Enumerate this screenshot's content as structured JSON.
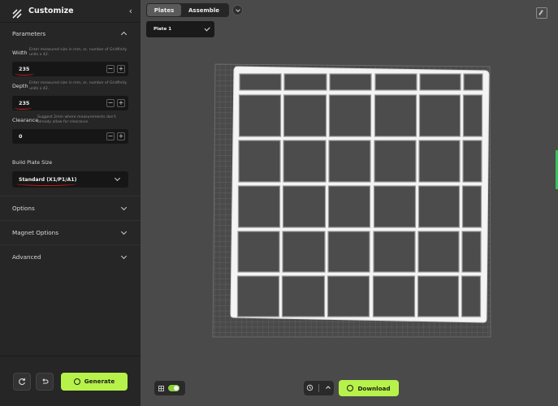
{
  "sidebar": {
    "title": "Customize",
    "parameters_label": "Parameters",
    "width": {
      "label": "Width",
      "help": "Enter measured size in mm, or, number of Gridfinity units x 42.",
      "value": "235"
    },
    "depth": {
      "label": "Depth",
      "help": "Enter measured size in mm, or, number of Gridfinity units x 42.",
      "value": "235"
    },
    "clearance": {
      "label": "Clearance",
      "help": "Suggest 2mm where measurements don't already allow for clearance.",
      "value": "0"
    },
    "build_plate": {
      "label": "Build Plate Size",
      "value": "Standard (X1/P1/A1)"
    },
    "sections": [
      "Options",
      "Magnet Options",
      "Advanced"
    ],
    "generate_label": "Generate"
  },
  "tabs": {
    "plates": "Plates",
    "assemble": "Assemble"
  },
  "plate_dropdown": {
    "selected": "Plate 1"
  },
  "bottom": {
    "download_label": "Download",
    "grid_toggle_on": true
  },
  "colors": {
    "accent": "#b6f24a",
    "annotation_red": "#d11a1a",
    "viewport_bg": "#4a4a4a",
    "sidebar_bg": "#262626"
  }
}
